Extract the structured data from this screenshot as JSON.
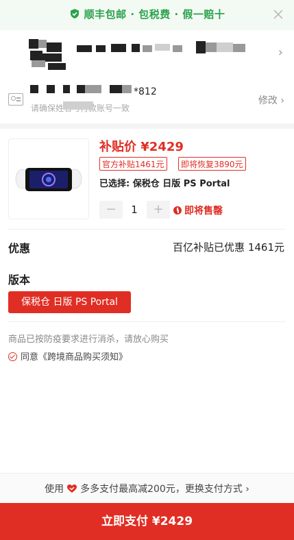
{
  "banner": {
    "text": "顺丰包邮 · 包税费 · 假一赔十",
    "close_icon": "close-icon",
    "color": "#2aa24c"
  },
  "address": {
    "name_tail": "*812",
    "hint": "请确保姓名与付款账号一致",
    "edit_label": "修改"
  },
  "product": {
    "price_label": "补贴价",
    "price": "¥2429",
    "tag_official": "官方补贴1461元",
    "tag_restore": "即将恢复3890元",
    "selected": "已选择: 保税仓 日版 PS Portal",
    "qty_minus": "−",
    "qty_value": "1",
    "qty_plus": "+",
    "soon_sold_out": "即将售罄"
  },
  "discount": {
    "label": "优惠",
    "value": "百亿补贴已优惠 1461元"
  },
  "version": {
    "label": "版本",
    "option": "保税仓 日版 PS Portal"
  },
  "notice": "商品已按防疫要求进行消杀，请放心购买",
  "agree": "同意《跨境商品购买须知》",
  "pay_tip": {
    "prefix": "使用",
    "text": "多多支付最高减200元，更换支付方式 ›"
  },
  "pay_button": "立即支付 ¥2429",
  "colors": {
    "accent": "#e02e24",
    "green": "#2aa24c"
  }
}
